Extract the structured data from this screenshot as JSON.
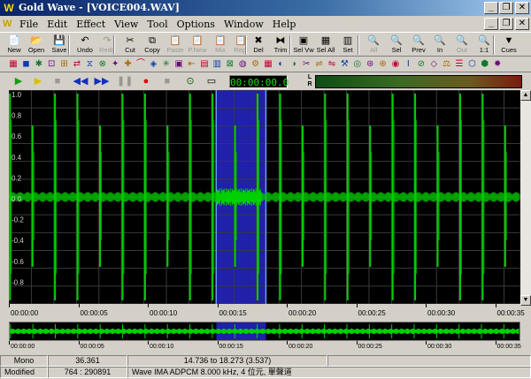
{
  "window": {
    "title": "Gold Wave - [VOICE004.WAV]",
    "minimize": "_",
    "restore": "❐",
    "close": "✕"
  },
  "menu": [
    "File",
    "Edit",
    "Effect",
    "View",
    "Tool",
    "Options",
    "Window",
    "Help"
  ],
  "toolbar": {
    "buttons": [
      {
        "label": "New",
        "icon": "new-doc-icon",
        "glyph": "📄",
        "enabled": true
      },
      {
        "label": "Open",
        "icon": "open-folder-icon",
        "glyph": "📂",
        "enabled": true
      },
      {
        "label": "Save",
        "icon": "save-icon",
        "glyph": "💾",
        "enabled": true
      },
      {
        "label": "Undo",
        "icon": "undo-icon",
        "glyph": "↶",
        "enabled": true
      },
      {
        "label": "Redo",
        "icon": "redo-icon",
        "glyph": "↷",
        "enabled": false
      },
      {
        "label": "Cut",
        "icon": "scissors-icon",
        "glyph": "✂",
        "enabled": true
      },
      {
        "label": "Copy",
        "icon": "copy-icon",
        "glyph": "⧉",
        "enabled": true
      },
      {
        "label": "Paste",
        "icon": "paste-icon",
        "glyph": "📋",
        "enabled": false
      },
      {
        "label": "P.New",
        "icon": "paste-new-icon",
        "glyph": "📋",
        "enabled": false
      },
      {
        "label": "Mix",
        "icon": "mix-icon",
        "glyph": "📋",
        "enabled": false
      },
      {
        "label": "Repl",
        "icon": "replace-icon",
        "glyph": "📋",
        "enabled": false
      },
      {
        "label": "Del",
        "icon": "delete-icon",
        "glyph": "✖",
        "enabled": true
      },
      {
        "label": "Trim",
        "icon": "trim-icon",
        "glyph": "⧓",
        "enabled": true
      },
      {
        "label": "Sel Vw",
        "icon": "select-view-icon",
        "glyph": "▣",
        "enabled": true
      },
      {
        "label": "Sel All",
        "icon": "select-all-icon",
        "glyph": "▦",
        "enabled": true
      },
      {
        "label": "Set",
        "icon": "set-marker-icon",
        "glyph": "▥",
        "enabled": true
      },
      {
        "label": "All",
        "icon": "zoom-all-icon",
        "glyph": "🔍",
        "enabled": false
      },
      {
        "label": "Sel",
        "icon": "zoom-selection-icon",
        "glyph": "🔍",
        "enabled": true
      },
      {
        "label": "Prev",
        "icon": "zoom-previous-icon",
        "glyph": "🔍",
        "enabled": true
      },
      {
        "label": "In",
        "icon": "zoom-in-icon",
        "glyph": "🔍",
        "enabled": true
      },
      {
        "label": "Out",
        "icon": "zoom-out-icon",
        "glyph": "🔍",
        "enabled": false
      },
      {
        "label": "1:1",
        "icon": "zoom-actual-icon",
        "glyph": "🔍",
        "enabled": true
      },
      {
        "label": "Cues",
        "icon": "cues-icon",
        "glyph": "▼",
        "enabled": true
      }
    ]
  },
  "effects_toolbar": {
    "icons": [
      "effect-1-icon",
      "effect-2-icon",
      "effect-3-icon",
      "effect-4-icon",
      "effect-5-icon",
      "effect-6-icon",
      "effect-7-icon",
      "effect-8-icon",
      "effect-9-icon",
      "effect-10-icon",
      "effect-11-icon",
      "effect-12-icon",
      "effect-13-icon",
      "effect-14-icon",
      "effect-15-icon",
      "effect-16-icon",
      "effect-17-icon",
      "effect-18-icon",
      "effect-19-icon",
      "effect-20-icon",
      "effect-21-icon",
      "effect-22-icon",
      "effect-23-icon",
      "effect-24-icon",
      "effect-25-icon",
      "effect-26-icon",
      "effect-27-icon",
      "effect-28-icon",
      "effect-29-icon",
      "effect-30-icon",
      "effect-31-icon",
      "effect-32-icon",
      "effect-33-icon",
      "effect-34-icon",
      "effect-35-icon",
      "effect-36-icon",
      "effect-37-icon",
      "effect-38-icon",
      "effect-39-icon"
    ],
    "colors": [
      "#c0002f",
      "#0a3ea8",
      "#0a7a2a",
      "#6a0a7a",
      "#a86a0a"
    ]
  },
  "transport": {
    "counter": "00:00:00.0",
    "meter_channels": "L R",
    "buttons": [
      {
        "name": "play-icon",
        "glyph": "▶",
        "color": "#10a010"
      },
      {
        "name": "play-selection-icon",
        "glyph": "▶",
        "color": "#d8c000"
      },
      {
        "name": "stop-disabled-icon",
        "glyph": "■",
        "color": "#9a9890"
      },
      {
        "name": "rewind-icon",
        "glyph": "◀◀",
        "color": "#1030c0"
      },
      {
        "name": "fast-forward-icon",
        "glyph": "▶▶",
        "color": "#1030c0"
      },
      {
        "name": "pause-icon",
        "glyph": "❚❚",
        "color": "#9a9890"
      },
      {
        "name": "record-icon",
        "glyph": "●",
        "color": "#e00000"
      },
      {
        "name": "stop-icon",
        "glyph": "■",
        "color": "#9a9890"
      },
      {
        "name": "device-settings-icon",
        "glyph": "⊙",
        "color": "#106010"
      },
      {
        "name": "window-icon",
        "glyph": "▭",
        "color": "#000000"
      }
    ]
  },
  "waveform": {
    "y_labels": [
      "1.0",
      "0.8",
      "0.6",
      "0.4",
      "0.2",
      "0.0",
      "-0.2",
      "-0.4",
      "-0.6",
      "-0.8"
    ],
    "selection_start": 14.736,
    "selection_end": 18.273,
    "duration": 36.361,
    "wave_color": "#00d000",
    "selection_color": "#2020a8",
    "grid_color": "#3a3a3a"
  },
  "timeline": {
    "labels": [
      "00:00:00",
      "00:00:05",
      "00:00:10",
      "00:00:15",
      "00:00:20",
      "00:00:25",
      "00:00:30",
      "00:00:35"
    ]
  },
  "overview": {
    "labels": [
      "00:00:00",
      "00:00:05",
      "00:00:10",
      "00:00:15",
      "00:00:20",
      "00:00:25",
      "00:00:30",
      "00:00:35"
    ]
  },
  "status": {
    "channels": "Mono",
    "length": "36.361",
    "selection": "14.736 to 18.273 (3.537)",
    "state": "Modified",
    "position": "764 : 290891",
    "format": "Wave IMA ADPCM 8.000 kHz, 4 位元, 單聲道"
  }
}
